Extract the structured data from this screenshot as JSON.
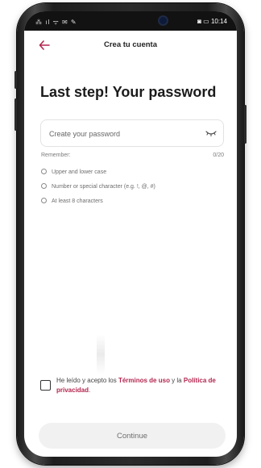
{
  "statusbar": {
    "left_icons": "⁂ ıl ᯤ ✉ ✎",
    "right_icons": "◙ ▭ ",
    "time": "10:14"
  },
  "appbar": {
    "back_icon": "arrow-left-icon",
    "title": "Crea tu cuenta"
  },
  "main": {
    "headline": "Last step! Your password",
    "password": {
      "placeholder": "Create your password",
      "value": "",
      "eye_icon": "eye-closed-icon"
    },
    "remember_label": "Remember:",
    "counter": "0/20",
    "requirements": [
      "Upper and lower case",
      "Number or special character (e.g. !, @, #)",
      "At least 8 characters"
    ]
  },
  "terms": {
    "checked": false,
    "prefix": "He leído y acepto los ",
    "terms_link": "Términos de uso",
    "middle": " y la ",
    "privacy_link": "Política de privacidad",
    "suffix": "."
  },
  "footer": {
    "continue_label": "Continue"
  },
  "colors": {
    "accent": "#b4254e",
    "button_bg": "#f1f1f1"
  }
}
